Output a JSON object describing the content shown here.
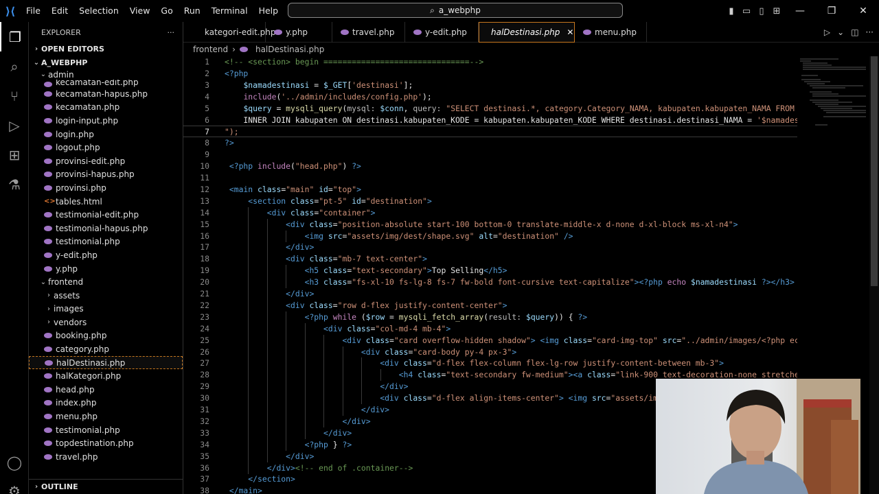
{
  "menus": [
    "File",
    "Edit",
    "Selection",
    "View",
    "Go",
    "Run",
    "Terminal",
    "Help"
  ],
  "search": {
    "text": "a_webphp"
  },
  "explorer": {
    "title": "EXPLORER",
    "more": "···",
    "open_editors": "OPEN EDITORS",
    "root": "A_WEBPHP",
    "admin_folder": "admin",
    "admin_files": [
      "kecamatan-edit.php",
      "kecamatan-hapus.php",
      "kecamatan.php",
      "login-input.php",
      "login.php",
      "logout.php",
      "provinsi-edit.php",
      "provinsi-hapus.php",
      "provinsi.php",
      "tables.html",
      "testimonial-edit.php",
      "testimonial-hapus.php",
      "testimonial.php",
      "y-edit.php",
      "y.php"
    ],
    "frontend_folder": "frontend",
    "frontend_subfolders": [
      "assets",
      "images",
      "vendors"
    ],
    "frontend_files": [
      "booking.php",
      "category.php",
      "halDestinasi.php",
      "halKategori.php",
      "head.php",
      "index.php",
      "menu.php",
      "testimonial.php",
      "topdestination.php",
      "travel.php"
    ],
    "outline": "OUTLINE"
  },
  "tabs": [
    "kategori-edit.php",
    "y.php",
    "travel.php",
    "y-edit.php",
    "halDestinasi.php",
    "menu.php"
  ],
  "active_tab": "halDestinasi.php",
  "breadcrumb": [
    "frontend",
    "halDestinasi.php"
  ],
  "editor": {
    "current_line": 7,
    "lines": [
      "<!-- <section> begin ===============================-->",
      "<?php",
      "    $namadestinasi = $_GET['destinasi'];",
      "    include('../admin/includes/config.php');",
      "    $query = mysqli_query(mysql: $conn, query: \"SELECT destinasi.*, category.Category_NAMA, kabupaten.kabupaten_NAMA FROM",
      "    INNER JOIN kabupaten ON destinasi.kabupaten_KODE = kabupaten.kabupaten_KODE WHERE destinasi.destinasi_NAMA = '$namades",
      "\");",
      "?>",
      "",
      " <?php include(\"head.php\") ?>",
      "",
      " <main class=\"main\" id=\"top\">",
      "     <section class=\"pt-5\" id=\"destination\">",
      "         <div class=\"container\">",
      "             <div class=\"position-absolute start-100 bottom-0 translate-middle-x d-none d-xl-block ms-xl-n4\">",
      "                 <img src=\"assets/img/dest/shape.svg\" alt=\"destination\" />",
      "             </div>",
      "             <div class=\"mb-7 text-center\">",
      "                 <h5 class=\"text-secondary\">Top Selling</h5>",
      "                 <h3 class=\"fs-xl-10 fs-lg-8 fs-7 fw-bold font-cursive text-capitalize\"><?php echo $namadestinasi ?></h3>",
      "             </div>",
      "             <div class=\"row d-flex justify-content-center\">",
      "                 <?php while ($row = mysqli_fetch_array(result: $query)) { ?>",
      "                     <div class=\"col-md-4 mb-4\">",
      "                         <div class=\"card overflow-hidden shadow\"> <img class=\"card-img-top\" src=\"../admin/images/<?php ec",
      "                             <div class=\"card-body py-4 px-3\">",
      "                                 <div class=\"d-flex flex-column flex-lg-row justify-content-between mb-3\">",
      "                                     <h4 class=\"text-secondary fw-medium\"><a class=\"link-900 text-decoration-none stretche",
      "                                 </div>",
      "                                 <div class=\"d-flex align-items-center\"> <img src=\"assets/im",
      "                             </div>",
      "                         </div>",
      "                     </div>",
      "                 <?php } ?>",
      "             </div>",
      "         </div><!-- end of .container-->",
      "     </section>",
      " </main>"
    ]
  }
}
